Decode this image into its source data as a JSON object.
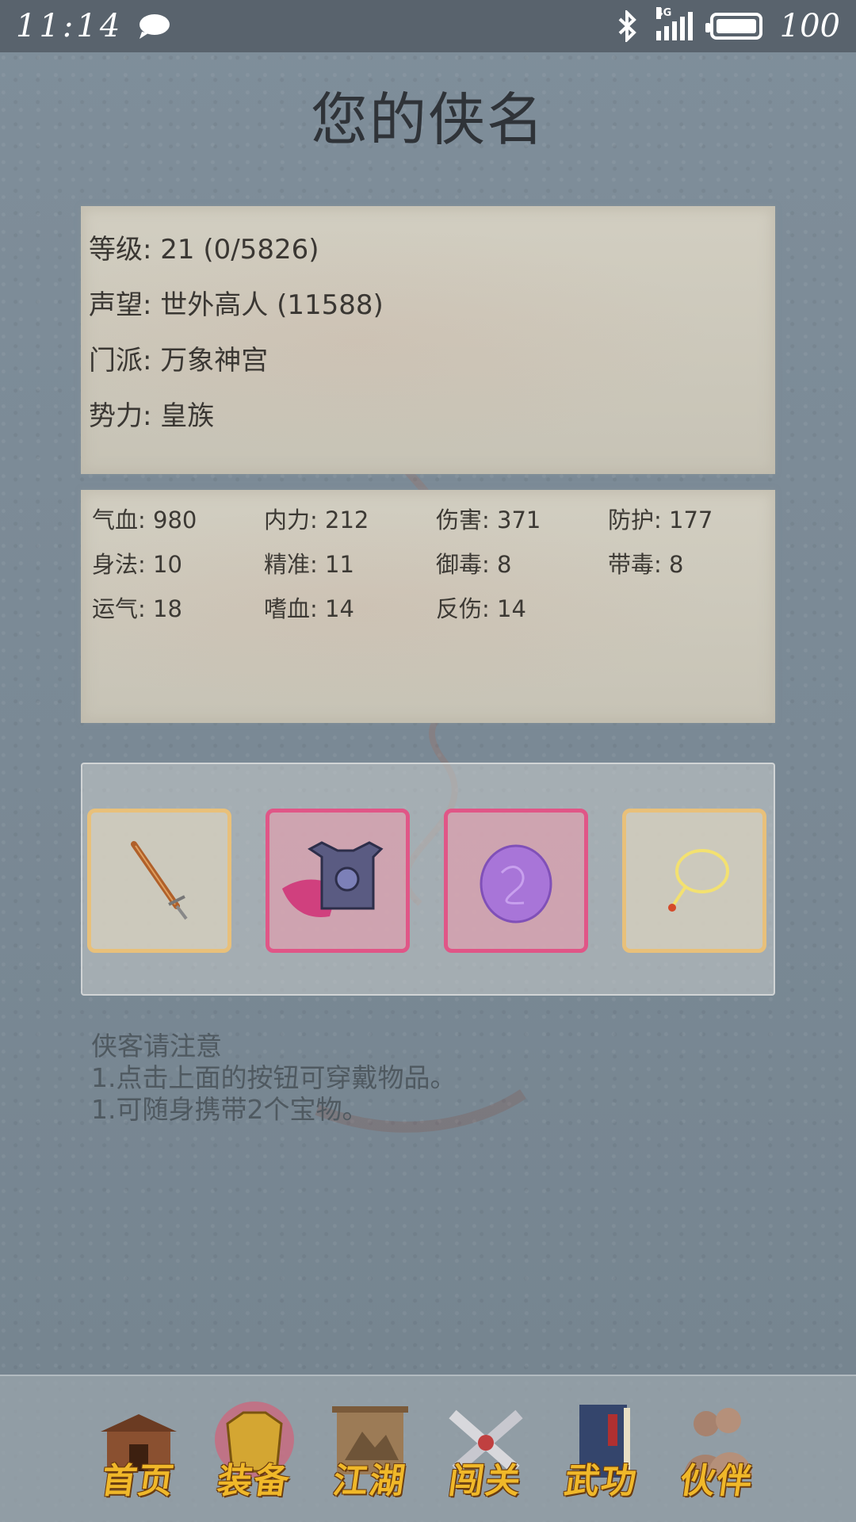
{
  "status_bar": {
    "time": "11:14",
    "network": "4G",
    "battery": "100"
  },
  "page": {
    "title": "您的侠名"
  },
  "profile": {
    "level": "等级: 21 (0/5826)",
    "reputation": "声望: 世外高人 (11588)",
    "sect": "门派: 万象神宫",
    "faction": "势力:  皇族"
  },
  "stats": [
    "气血: 980",
    "内力: 212",
    "伤害: 371",
    "防护: 177",
    "身法: 10",
    "精准: 11",
    "御毒: 8",
    "带毒: 8",
    "运气: 18",
    "嗜血: 14",
    "反伤: 14"
  ],
  "equipment": [
    {
      "icon": "sword-icon",
      "rarity": "gold"
    },
    {
      "icon": "armor-icon",
      "rarity": "epic"
    },
    {
      "icon": "purple-orb-icon",
      "rarity": "epic"
    },
    {
      "icon": "necklace-icon",
      "rarity": "gold"
    }
  ],
  "notice": {
    "title": "侠客请注意",
    "line1": "1.点击上面的按钮可穿戴物品。",
    "line2": "1.可随身携带2个宝物。"
  },
  "nav": {
    "home": "首页",
    "equipment": "装备",
    "jianghu": "江湖",
    "challenge": "闯关",
    "martial": "武功",
    "partners": "伙伴"
  },
  "colors": {
    "gold_border": "#e8c07a",
    "epic_border": "#e05687",
    "nav_text": "#f0b829"
  }
}
